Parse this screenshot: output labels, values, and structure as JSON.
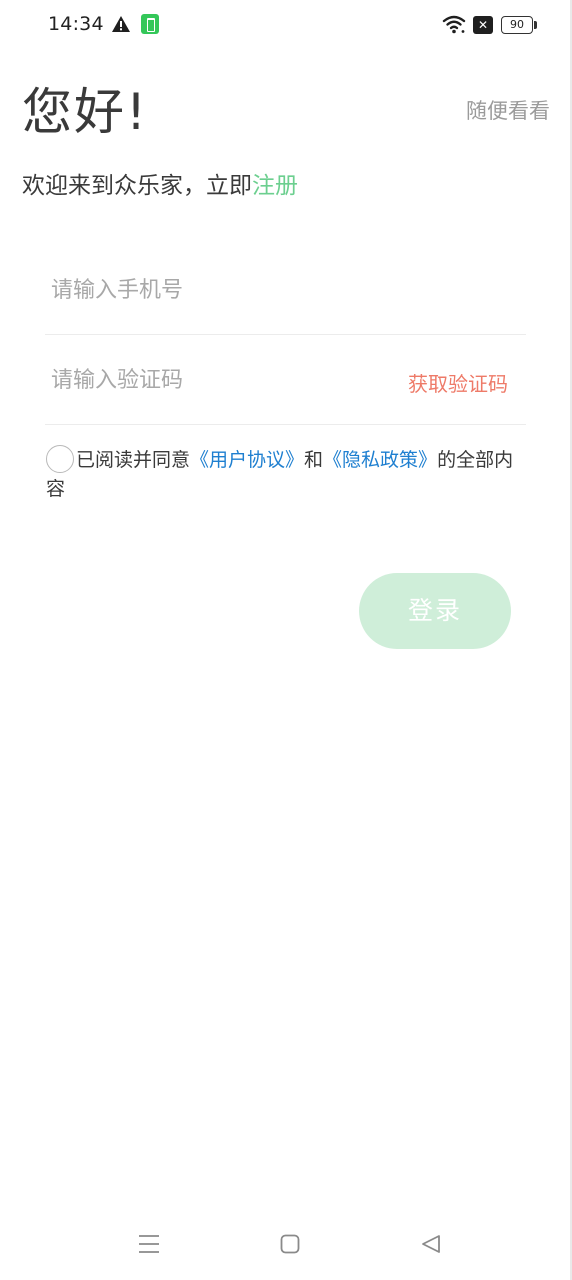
{
  "status_bar": {
    "time": "14:34",
    "battery": "90",
    "icons": [
      "warning-icon",
      "app-notification-icon",
      "wifi-icon",
      "sim-off-icon",
      "battery-icon"
    ]
  },
  "header": {
    "greeting": "您好!",
    "browse_label": "随便看看",
    "welcome_text": "欢迎来到众乐家，立即",
    "register_label": "注册"
  },
  "form": {
    "phone_placeholder": "请输入手机号",
    "phone_value": "",
    "code_placeholder": "请输入验证码",
    "code_value": "",
    "get_code_label": "获取验证码"
  },
  "agreement": {
    "checked": false,
    "prefix": "已阅读并同意",
    "user_agreement": "《用户协议》",
    "and": "和",
    "privacy_policy": "《隐私政策》",
    "suffix": "的全部内容"
  },
  "login_label": "登录",
  "colors": {
    "accent_green": "#6ccf8f",
    "login_button": "#cfeed9",
    "get_code": "#ee7a68",
    "link_blue": "#1e7fd0"
  },
  "nav_bar": {
    "icons": [
      "menu-icon",
      "home-icon",
      "back-icon"
    ]
  }
}
